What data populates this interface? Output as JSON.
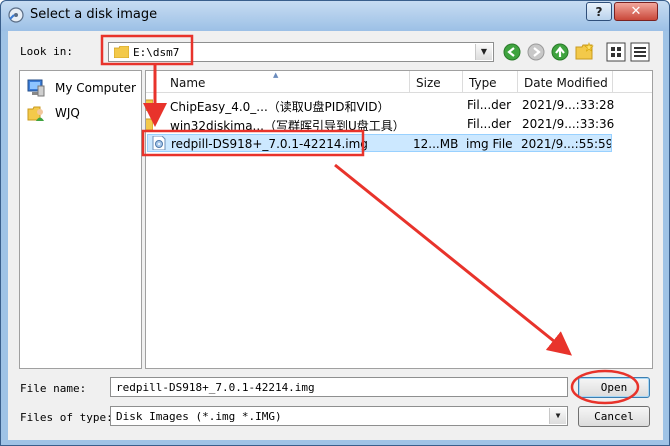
{
  "window": {
    "title": "Select a disk image"
  },
  "title_buttons": {
    "help": "?",
    "close": "✕"
  },
  "lookin": {
    "label": "Look in:",
    "value": "E:\\dsm7"
  },
  "places": [
    {
      "label": "My Computer",
      "icon": "computer-icon"
    },
    {
      "label": "WJQ",
      "icon": "user-folder-icon"
    }
  ],
  "columns": {
    "name": "Name",
    "size": "Size",
    "type": "Type",
    "date": "Date Modified"
  },
  "files": [
    {
      "name": "ChipEasy_4.0_...（读取U盘PID和VID）",
      "size": "",
      "type": "Fil...der",
      "date": "2021/9...:33:28",
      "icon": "folder-icon",
      "selected": false
    },
    {
      "name": "win32diskima...（写群晖引导到U盘工具）",
      "size": "",
      "type": "Fil...der",
      "date": "2021/9...:33:36",
      "icon": "folder-icon",
      "selected": false
    },
    {
      "name": "redpill-DS918+_7.0.1-42214.img",
      "size": "12...MB",
      "type": "img File",
      "date": "2021/9...:55:59",
      "icon": "disk-image-icon",
      "selected": true
    }
  ],
  "file_name": {
    "label": "File name:",
    "value": "redpill-DS918+_7.0.1-42214.img"
  },
  "file_type": {
    "label": "Files of type:",
    "value": "Disk Images (*.img *.IMG)"
  },
  "buttons": {
    "open": "Open",
    "cancel": "Cancel"
  },
  "colors": {
    "annotation": "#e8332b",
    "selection": "#cce8ff",
    "titlebar": "#9cc0e6"
  }
}
